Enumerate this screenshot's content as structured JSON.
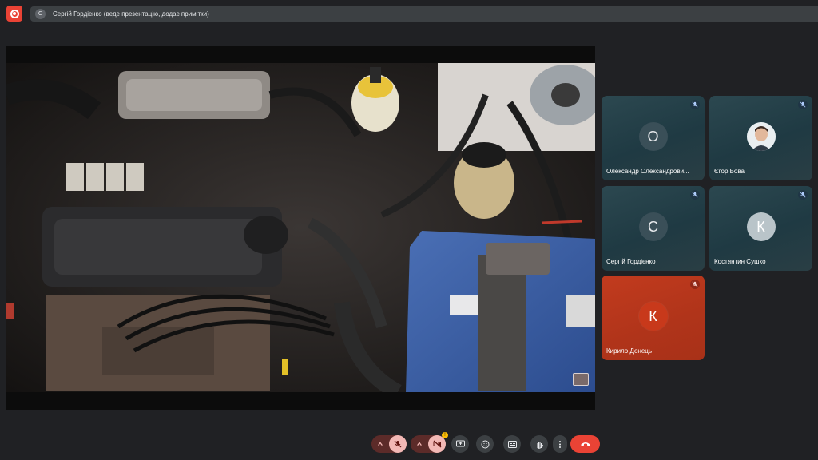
{
  "header": {
    "record_icon": "record-icon",
    "presenter_initial": "С",
    "presenter_label": "Сергій Гордієнко (веде презентацію, додає примітки)"
  },
  "participants": [
    {
      "initial": "О",
      "name": "Олександр Олександрови...",
      "avatar_color": "#3a4f58",
      "muted": true,
      "photo": false
    },
    {
      "initial": "",
      "name": "Єгор Бова",
      "avatar_color": "#8fb3c2",
      "muted": true,
      "photo": true
    },
    {
      "initial": "С",
      "name": "Сергій Гордієнко",
      "avatar_color": "#3a4f58",
      "muted": true,
      "photo": false
    },
    {
      "initial": "К",
      "name": "Костянтин Сушко",
      "avatar_color": "#b9c4c9",
      "muted": true,
      "photo": false
    },
    {
      "initial": "К",
      "name": "Кирило Донець",
      "avatar_color": "#c8391b",
      "muted": true,
      "photo": false
    }
  ],
  "toolbar": {
    "mic_state": "off",
    "camera_state": "off",
    "camera_badge": "!",
    "icons": [
      "chevron-up-icon",
      "mic-off-icon",
      "chevron-up-icon",
      "camera-off-icon",
      "present-icon",
      "emoji-icon",
      "captions-icon",
      "raise-hand-icon",
      "more-icon",
      "end-call-icon"
    ],
    "accent_red": "#ea4335",
    "muted_pink": "#f2b8b5"
  }
}
